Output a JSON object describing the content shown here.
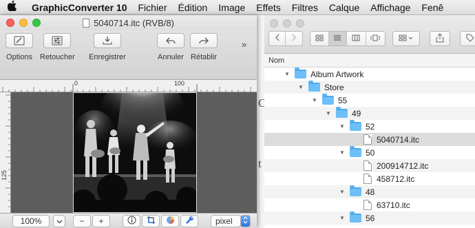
{
  "menubar": {
    "apple_icon": "apple-logo-icon",
    "app_name": "GraphicConverter 10",
    "items": [
      "Fichier",
      "Édition",
      "Image",
      "Effets",
      "Filtres",
      "Calque",
      "Affichage",
      "Fenê"
    ]
  },
  "image_window": {
    "title": "5040714.itc (RVB/8)",
    "toolbar": {
      "options": "Options",
      "retouch": "Retoucher",
      "save": "Enregistrer",
      "undo": "Annuler",
      "redo": "Rétablir",
      "overflow": "»"
    },
    "ruler": {
      "top_zero": "0",
      "top_mark": "100",
      "left_mark": "125"
    },
    "status": {
      "zoom": "100%",
      "zoom_minus": "−",
      "zoom_plus": "+",
      "unit": "pixel"
    }
  },
  "finder": {
    "column_header": "Nom",
    "rows": [
      {
        "name": "Album Artwork",
        "kind": "folder",
        "expanded": true,
        "depth": 0
      },
      {
        "name": "Store",
        "kind": "folder",
        "expanded": true,
        "depth": 1
      },
      {
        "name": "55",
        "kind": "folder",
        "expanded": true,
        "depth": 2
      },
      {
        "name": "49",
        "kind": "folder",
        "expanded": true,
        "depth": 3
      },
      {
        "name": "52",
        "kind": "folder",
        "expanded": true,
        "depth": 4
      },
      {
        "name": "5040714.itc",
        "kind": "file",
        "depth": 5,
        "selected": true
      },
      {
        "name": "50",
        "kind": "folder",
        "expanded": true,
        "depth": 4
      },
      {
        "name": "200914712.itc",
        "kind": "file",
        "depth": 5
      },
      {
        "name": "458712.itc",
        "kind": "file",
        "depth": 5
      },
      {
        "name": "48",
        "kind": "folder",
        "expanded": true,
        "depth": 4
      },
      {
        "name": "63710.itc",
        "kind": "file",
        "depth": 5
      },
      {
        "name": "56",
        "kind": "folder",
        "expanded": true,
        "depth": 4
      }
    ]
  },
  "background_window_glyphs": [
    "C",
    "t"
  ]
}
